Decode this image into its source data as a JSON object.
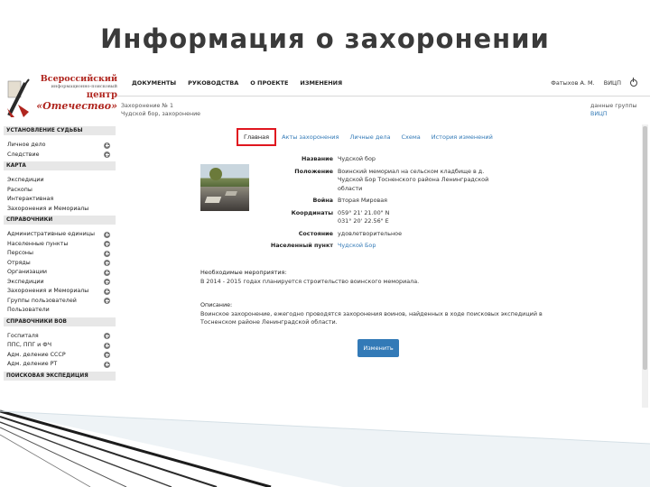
{
  "slide": {
    "title": "Информация о захоронении"
  },
  "logo": {
    "line1": "Всероссийский",
    "line2": "информационно-поисковый",
    "line3": "центр",
    "line4": "«Отечество»"
  },
  "topnav": [
    "ДОКУМЕНТЫ",
    "РУКОВОДСТВА",
    "О ПРОЕКТЕ",
    "ИЗМЕНЕНИЯ"
  ],
  "user": {
    "name": "Фатыхов А. М.",
    "group": "ВИЦП"
  },
  "breadcrumb": {
    "line1": "Захоронение № 1",
    "line2": "Чудской бор, захоронение",
    "right_line1": "данные группы",
    "right_line2": "ВИЦП"
  },
  "sidebar": {
    "sec1": "УСТАНОВЛЕНИЕ СУДЬБЫ",
    "sec1_items": [
      "Личное дело",
      "Следствие"
    ],
    "sec2": "КАРТА",
    "sec2_items": [
      "Экспедиции",
      "Раскопы",
      "Интерактивная",
      "Захоронения и Мемориалы"
    ],
    "sec3": "СПРАВОЧНИКИ",
    "sec3_items": [
      "Административные единицы",
      "Населенные пункты",
      "Персоны",
      "Отряды",
      "Организации",
      "Экспедиции",
      "Захоронения и Мемориалы",
      "Группы пользователей",
      "Пользователи"
    ],
    "sec4": "СПРАВОЧНИКИ ВОВ",
    "sec4_items": [
      "Госпиталя",
      "ППС, ППГ и ФЧ",
      "Адм. деление СССР",
      "Адм. деление РТ"
    ],
    "sec5": "ПОИСКОВАЯ ЭКСПЕДИЦИЯ"
  },
  "tabs": [
    "Главная",
    "Акты захоронения",
    "Личные дела",
    "Схема",
    "История изменений"
  ],
  "details": [
    {
      "label": "Название",
      "value": "Чудской бор"
    },
    {
      "label": "Положение",
      "value": "Воинский мемориал на сельском кладбище в д. Чудской Бор Тосненского района Ленинградской области"
    },
    {
      "label": "Война",
      "value": "Вторая Мировая"
    },
    {
      "label": "Координаты",
      "value": "059° 21' 21.00\" N\n031° 20' 22.56\" E"
    },
    {
      "label": "Состояние",
      "value": "удовлетворительное"
    },
    {
      "label": "Населенный пункт",
      "value": "Чудской Бор",
      "link": true
    }
  ],
  "needed": {
    "title": "Необходимые мероприятия:",
    "text": "В 2014 - 2015 годах планируется строительство воинского мемориала."
  },
  "description": {
    "title": "Описание:",
    "text": "Воинское захоронение, ежегодно проводятся захоронения воинов, найденных в ходе поисковых экспедиций в Тосненском районе Ленинградской области."
  },
  "edit_button": "Изменить"
}
